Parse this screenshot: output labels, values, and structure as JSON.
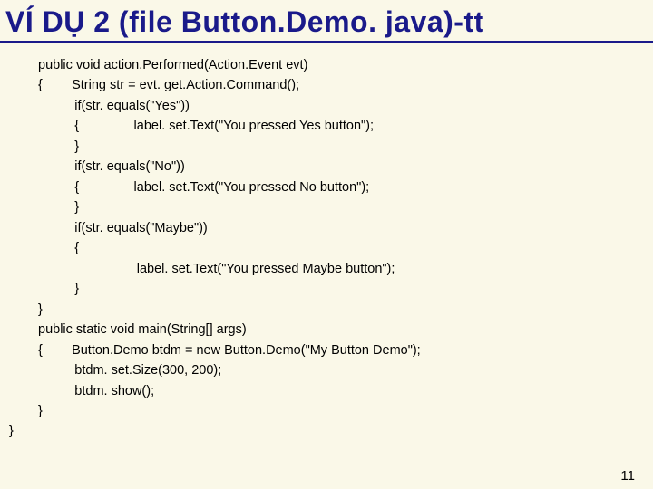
{
  "title": "VÍ DỤ 2 (file Button.Demo. java)-tt",
  "page_number": "11",
  "code_lines": [
    "public void action.Performed(Action.Event evt)",
    "{        String str = evt. get.Action.Command();",
    "          if(str. equals(\"Yes\"))",
    "          {               label. set.Text(\"You pressed Yes button\");",
    "          }",
    "          if(str. equals(\"No\"))",
    "          {               label. set.Text(\"You pressed No button\");",
    "          }",
    "          if(str. equals(\"Maybe\"))",
    "          {",
    "                           label. set.Text(\"You pressed Maybe button\");",
    "          }",
    "}",
    "public static void main(String[] args)",
    "{        Button.Demo btdm = new Button.Demo(\"My Button Demo\");",
    "          btdm. set.Size(300, 200);",
    "          btdm. show();",
    "}"
  ],
  "closing_brace": "}"
}
